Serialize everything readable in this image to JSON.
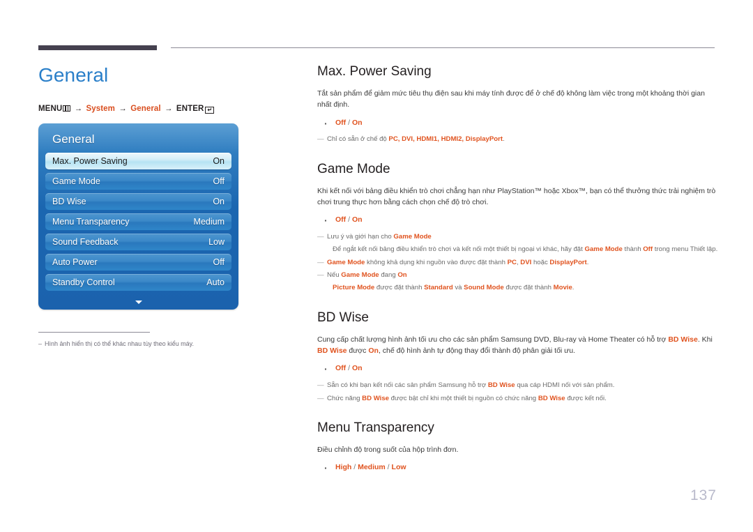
{
  "header": {
    "rule_dark_color": "#45414f",
    "rule_thin_color": "#8c8a96"
  },
  "left": {
    "section_title": "General",
    "breadcrumb": {
      "menu_label": "MENU",
      "menu_icon": "menu-grid-icon",
      "arrow": "→",
      "step_system": "System",
      "step_general": "General",
      "enter_label": "ENTER",
      "enter_icon": "enter-key-icon",
      "enter_glyph": "↵",
      "highlight_color": "#d94e1f"
    },
    "osd": {
      "title": "General",
      "scroll_icon": "caret-down-icon",
      "rows": [
        {
          "label": "Max. Power Saving",
          "value": "On",
          "selected": true
        },
        {
          "label": "Game Mode",
          "value": "Off",
          "selected": false
        },
        {
          "label": "BD Wise",
          "value": "On",
          "selected": false
        },
        {
          "label": "Menu Transparency",
          "value": "Medium",
          "selected": false
        },
        {
          "label": "Sound Feedback",
          "value": "Low",
          "selected": false
        },
        {
          "label": "Auto Power",
          "value": "Off",
          "selected": false
        },
        {
          "label": "Standby Control",
          "value": "Auto",
          "selected": false
        }
      ]
    },
    "footnote": {
      "dash": "–",
      "text": "Hình ảnh hiển thị có thể khác nhau tùy theo kiểu máy."
    }
  },
  "right": {
    "max_power_saving": {
      "heading": "Max. Power Saving",
      "body": "Tắt sản phẩm để giảm mức tiêu thụ điện sau khi máy tính được để ở chế độ không làm việc trong một khoảng thời gian nhất định.",
      "option_off": "Off",
      "option_sep": " / ",
      "option_on": "On",
      "note_prefix": "Chỉ có sẵn ở chế độ ",
      "note_terms": "PC, DVI, HDMI1, HDMI2, DisplayPort",
      "note_suffix": "."
    },
    "game_mode": {
      "heading": "Game Mode",
      "body": "Khi kết nối với bảng điều khiển trò chơi chẳng hạn như PlayStation™ hoặc Xbox™, bạn có thể thưởng thức trải nghiệm trò chơi trung thực hơn bằng cách chọn chế độ trò chơi.",
      "option_off": "Off",
      "option_sep": " / ",
      "option_on": "On",
      "note1_prefix": "Lưu ý và giới hạn cho ",
      "note1_term": "Game Mode",
      "note1_sub_a": "Để ngắt kết nối bảng điều khiển trò chơi và kết nối một thiết bị ngoại vi khác, hãy đặt ",
      "note1_sub_term1": "Game Mode",
      "note1_sub_b": " thành ",
      "note1_sub_term2": "Off",
      "note1_sub_c": " trong menu Thiết lập.",
      "note2_term1": "Game Mode",
      "note2_a": " không khả dụng khi nguồn vào được đặt thành ",
      "note2_term2": "PC",
      "note2_b": ", ",
      "note2_term3": "DVI",
      "note2_c": " hoặc ",
      "note2_term4": "DisplayPort",
      "note2_d": ".",
      "note3_a": "Nếu ",
      "note3_term1": "Game Mode",
      "note3_b": " đang ",
      "note3_term2": "On",
      "note3_sub_term1": "Picture Mode",
      "note3_sub_a": " được đặt thành ",
      "note3_sub_term2": "Standard",
      "note3_sub_b": " và ",
      "note3_sub_term3": "Sound Mode",
      "note3_sub_c": " được đặt thành ",
      "note3_sub_term4": "Movie",
      "note3_sub_d": "."
    },
    "bd_wise": {
      "heading": "BD Wise",
      "body_a": "Cung cấp chất lượng hình ảnh tối ưu cho các sản phẩm Samsung DVD, Blu-ray và Home Theater có hỗ trợ ",
      "body_term1": "BD Wise",
      "body_b": ". Khi ",
      "body_term2": "BD Wise",
      "body_c": " được ",
      "body_term3": "On",
      "body_d": ", chế độ hình ảnh tự động thay đổi thành độ phân giải tối ưu.",
      "option_off": "Off",
      "option_sep": " / ",
      "option_on": "On",
      "note1_a": "Sẵn có khi bạn kết nối các sản phẩm Samsung hỗ trợ ",
      "note1_term": "BD Wise",
      "note1_b": " qua cáp HDMI nối với sản phẩm.",
      "note2_a": "Chức năng ",
      "note2_term1": "BD Wise",
      "note2_b": " được bật chỉ khi một thiết bị nguồn có chức năng ",
      "note2_term2": "BD Wise",
      "note2_c": " được kết nối."
    },
    "menu_transparency": {
      "heading": "Menu Transparency",
      "body": "Điều chỉnh độ trong suốt của hộp trình đơn.",
      "option_high": "High",
      "option_sep1": " / ",
      "option_medium": "Medium",
      "option_sep2": " / ",
      "option_low": "Low"
    }
  },
  "page_number": "137"
}
